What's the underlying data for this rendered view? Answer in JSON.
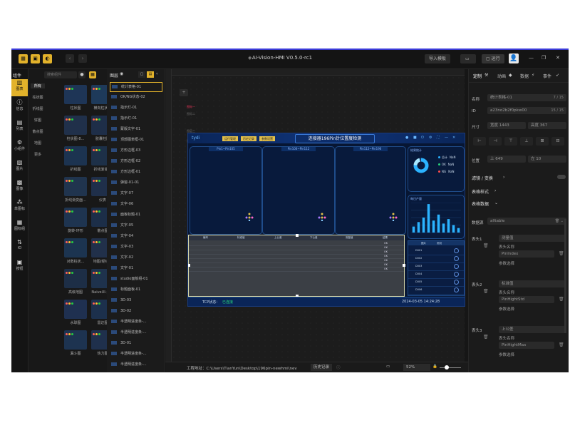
{
  "titlebar": {
    "title": "AI-Vision-HMI V0.5.0-rc1",
    "import_label": "导入模板",
    "export_label": "",
    "run_label": "运行"
  },
  "iconbar": [
    {
      "label": "图表",
      "icon": "chart-icon"
    },
    {
      "label": "信息",
      "icon": "info-icon"
    },
    {
      "label": "列表",
      "icon": "list-icon"
    },
    {
      "label": "小组件",
      "icon": "widget-icon"
    },
    {
      "label": "图片",
      "icon": "image-icon"
    },
    {
      "label": "图像",
      "icon": "picture-icon"
    },
    {
      "label": "单图标",
      "icon": "icon-icon"
    },
    {
      "label": "图标组",
      "icon": "icon-group-icon"
    },
    {
      "label": "IO",
      "icon": "io-icon"
    },
    {
      "label": "按钮",
      "icon": "button-icon"
    }
  ],
  "complib": {
    "header": "组件",
    "search_placeholder": "搜索组件",
    "categories": [
      "所有",
      "柱状图",
      "折线图",
      "饼图",
      "散点图",
      "地图",
      "更多"
    ],
    "tiles": [
      "柱状图",
      "横向柱状图",
      "柱状图-8...",
      "胶囊柱图",
      "折线图",
      "折线渐变图",
      "折线渐变面...",
      "仪表",
      "旋转-环形",
      "散点图",
      "对数柱状...",
      "地图/经线...",
      "高级地图",
      "NaiveUI-进度",
      "水球图",
      "雷达图",
      "漏斗图",
      "热力图"
    ]
  },
  "layers": {
    "header": "图层",
    "items": [
      "统计表格-01",
      "OK/NG状态-02",
      "指示灯-01",
      "指示灯-01",
      "蒙版文字-01",
      "顶部图表框-01",
      "方形边框-03",
      "方形边框-02",
      "方形边框-01",
      "弹窗-01-01",
      "文字-07",
      "文字-06",
      "面板标题-01",
      "文字-05",
      "文字-04",
      "文字-03",
      "文字-02",
      "文字-01",
      "studio面板组-01",
      "标题面板-01",
      "3D-03",
      "3D-02",
      "半透明进度条-...",
      "半透明进度条-...",
      "3D-01",
      "半透明进度条-...",
      "半透明进度条-..."
    ]
  },
  "canvas": {
    "label_a": "图标一",
    "label_b": "图标二",
    "label_c": "图层三",
    "label_d": "图层四"
  },
  "dashboard": {
    "brand": "tydi",
    "title": "连接器196Pin针位置度检测",
    "buttons": [
      "运行管理",
      "历史记录",
      "参数设置"
    ],
    "pin_panels": [
      "Pin1~Pin105",
      "Pin106~Pin112",
      "Pin112~Pin196"
    ],
    "stats_title": "结果统计",
    "stats": [
      {
        "label": "总计",
        "value": "NaN"
      },
      {
        "label": "OK",
        "value": "NaN"
      },
      {
        "label": "NG",
        "value": "NaN"
      }
    ],
    "donut_legend": [
      "OK",
      "NG"
    ],
    "production_title": "每日产量",
    "table_headers": [
      "编号",
      "标准值",
      "上公差",
      "下公差",
      "测量值",
      "结果"
    ],
    "result_values": [
      "OK",
      "OK",
      "OK",
      "OK",
      "OK",
      "OK",
      "OK"
    ],
    "right_table_headers": [
      "图片",
      "测试"
    ],
    "right_rows": [
      "D001",
      "D002",
      "D003",
      "D004",
      "D005",
      "D006"
    ],
    "footer_left": "TCP状态：",
    "footer_status": "已连接",
    "timestamp": "2024-03-05 14:24:28",
    "colors": {
      "bg": "#071633",
      "accent": "#2bb3ff",
      "gold": "#e3c04a",
      "green": "#27d07a",
      "red": "#ff4b4b"
    }
  },
  "chart_data": {
    "type": "bar",
    "categories": [
      "1",
      "2",
      "3",
      "4",
      "5",
      "6",
      "7",
      "8",
      "9",
      "10"
    ],
    "values": [
      20,
      35,
      50,
      95,
      40,
      60,
      30,
      45,
      25,
      15
    ],
    "title": "每日产量",
    "xlabel": "",
    "ylabel": "",
    "ylim": [
      0,
      100
    ]
  },
  "props": {
    "tabs": [
      "定制",
      "动画",
      "数据",
      "事件"
    ],
    "name_label": "名称",
    "name_value": "统计表格-01",
    "name_count": "7 / 15",
    "id_label": "ID",
    "id_value": "a23no2b2f0pkw00",
    "id_count": "15 / 15",
    "size_label": "尺寸",
    "width": "宽度 1443",
    "height": "高度 367",
    "pos_label": "位置",
    "pos_x": "上 649",
    "pos_y": "左 10",
    "filter_label": "滤镜 / 变换",
    "style_label": "表格样式",
    "data_label": "表格数据",
    "source_label": "数据源",
    "source_value": "alltable",
    "col1_label": "表头1",
    "col1_title": "测量值",
    "col1_name_label": "表头名称",
    "col1_field": "PinIndex",
    "param_select": "参数选择",
    "col2_label": "表头2",
    "col2_title": "标准值",
    "col2_field": "PinHightStd",
    "col3_label": "表头3",
    "col3_title": "上公差",
    "col3_field": "PinHightMax"
  },
  "status": {
    "path": "工程地址：C:\\Users\\TianYun\\Desktop\\196pin-newhmi\\nev",
    "history": "历史记录",
    "zoom": "52%"
  }
}
